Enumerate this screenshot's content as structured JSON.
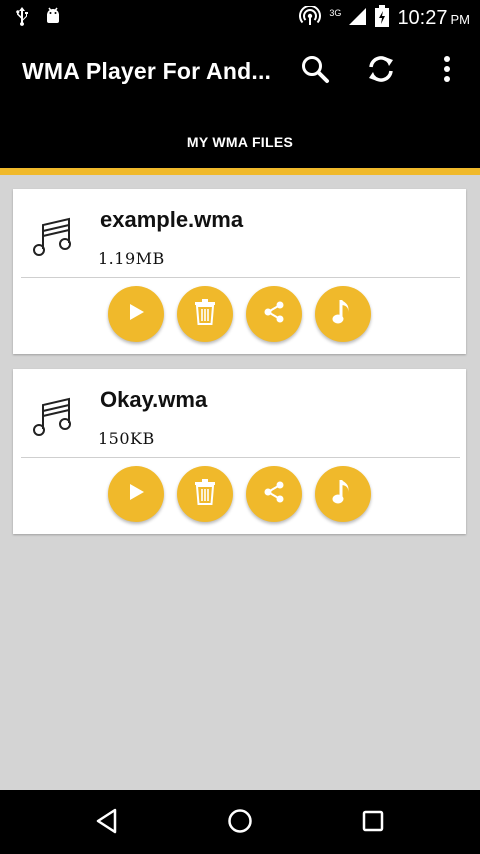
{
  "status_bar": {
    "time": "10:27",
    "ampm": "PM",
    "network": "3G",
    "icons": [
      "usb-icon",
      "android-debug-icon",
      "hotspot-icon",
      "signal-icon",
      "battery-icon"
    ]
  },
  "app_bar": {
    "title": "WMA Player For And...",
    "actions": [
      "search-icon",
      "refresh-icon",
      "overflow-menu-icon"
    ]
  },
  "tabs": [
    {
      "label": "MY WMA FILES",
      "selected": true
    }
  ],
  "colors": {
    "accent": "#f0b92b",
    "bar": "#000000",
    "background": "#d4d4d4"
  },
  "files": [
    {
      "name": "example.wma",
      "size": "1.19MB"
    },
    {
      "name": "Okay.wma",
      "size": "150KB"
    }
  ],
  "file_actions": [
    "play-icon",
    "delete-icon",
    "share-icon",
    "ringtone-icon"
  ],
  "nav_bar": [
    "back-icon",
    "home-icon",
    "recents-icon"
  ]
}
